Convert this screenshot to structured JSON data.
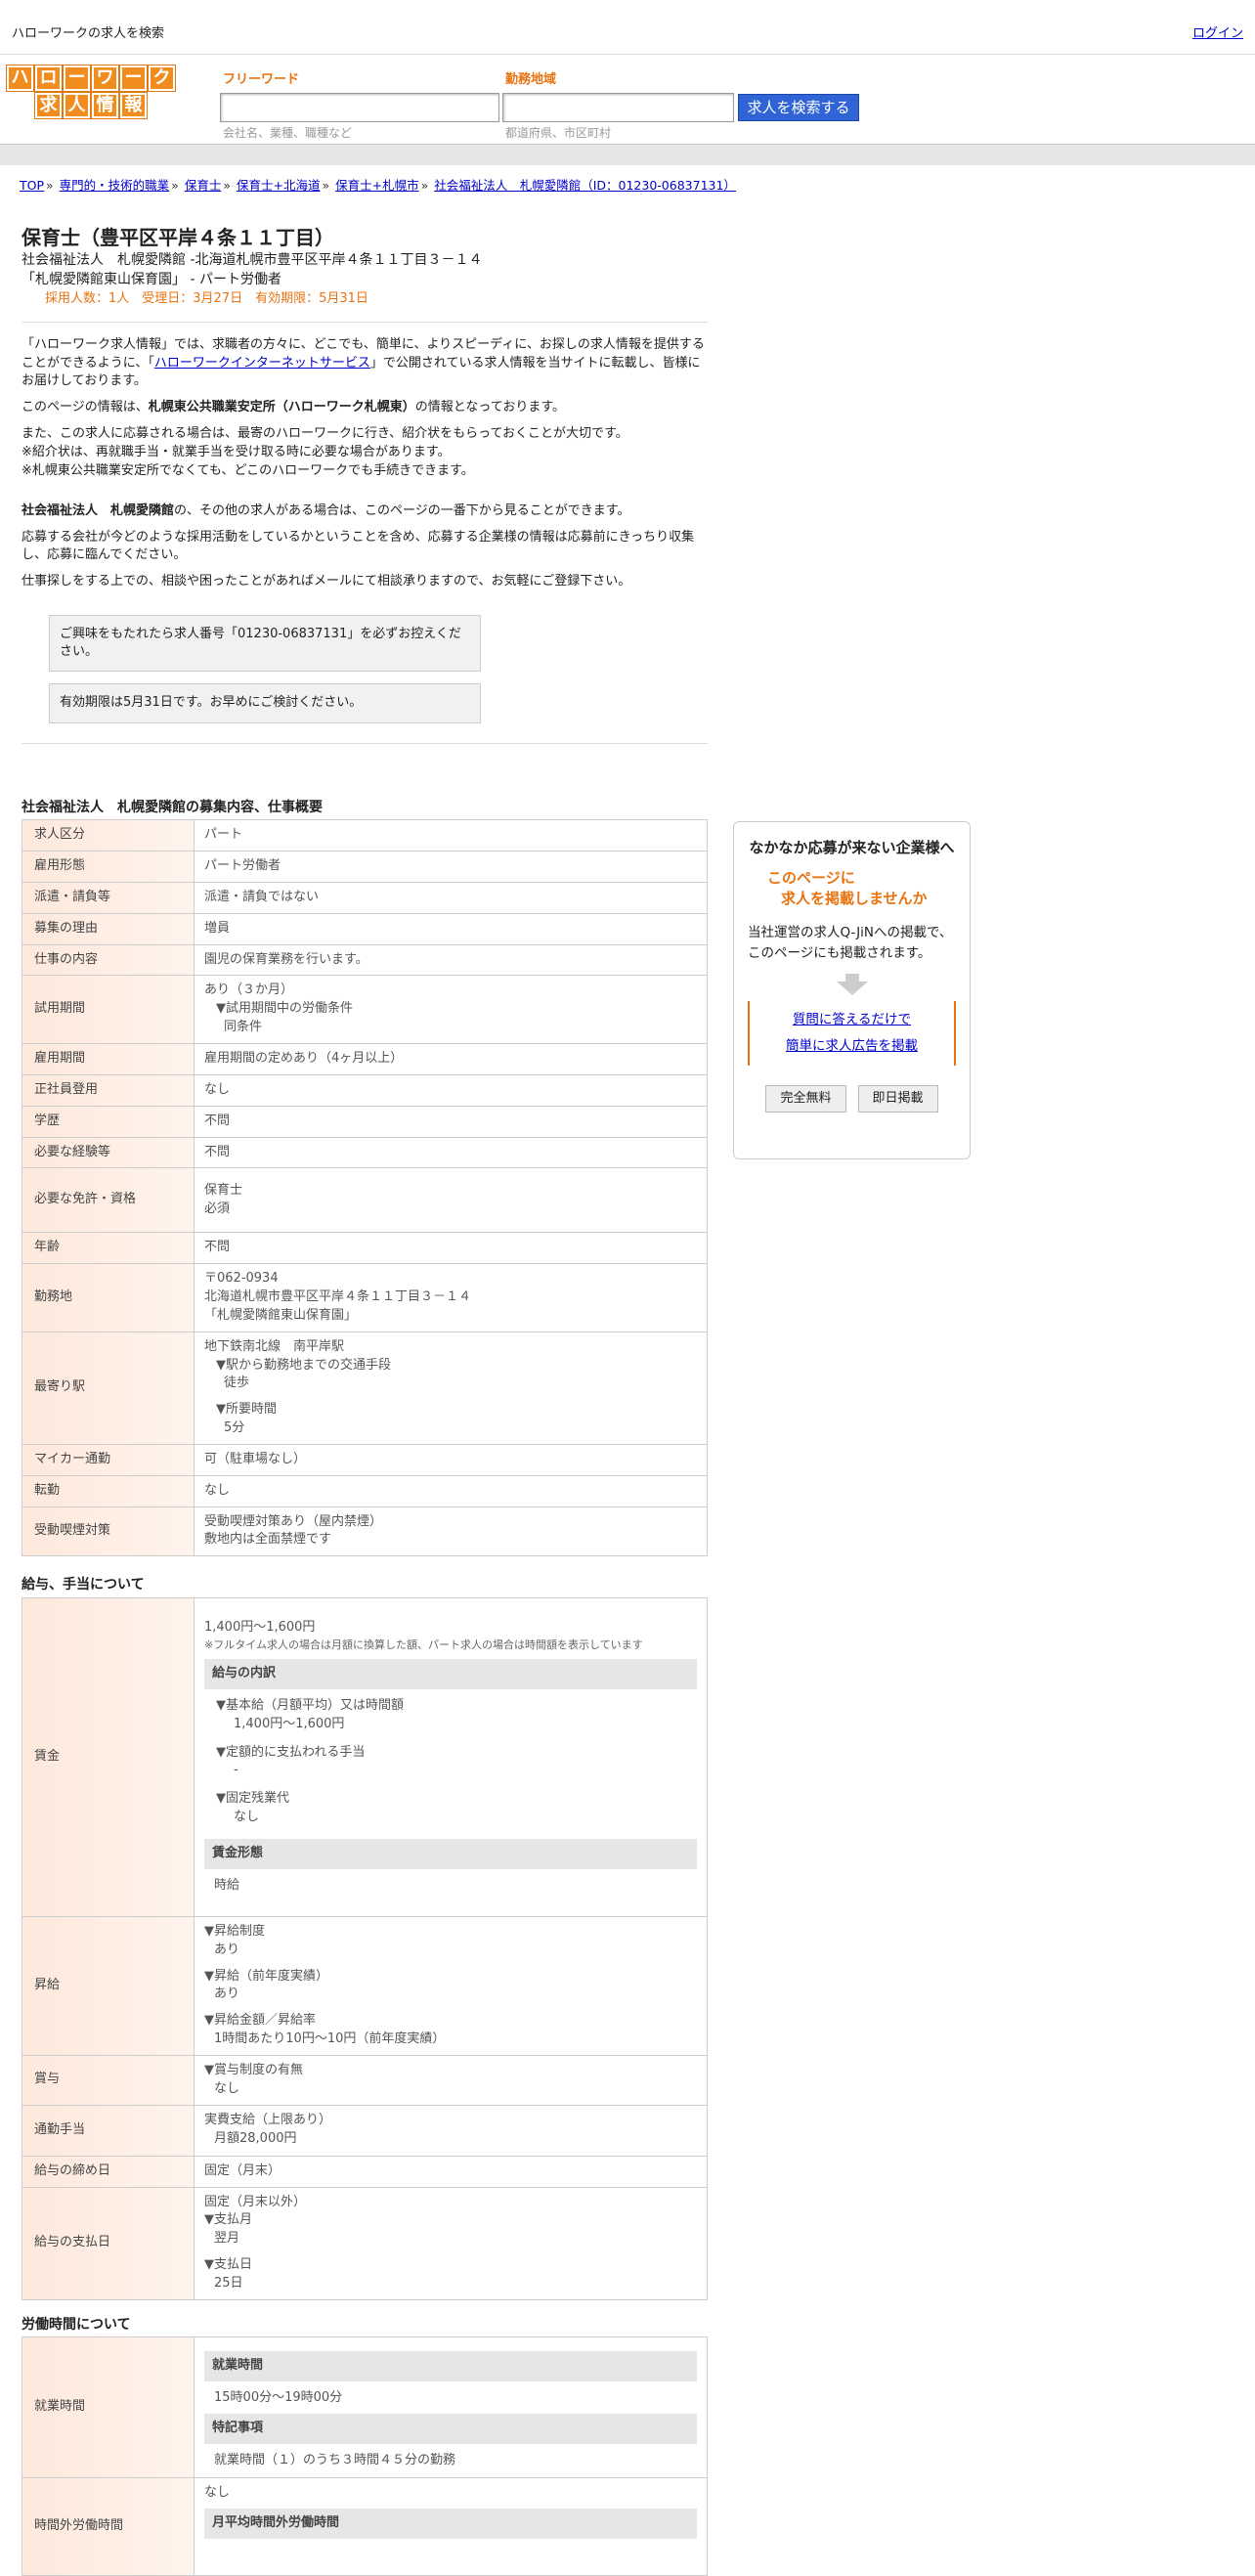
{
  "topbar": {
    "title": "ハローワークの求人を検索",
    "login": "ログイン"
  },
  "logo": {
    "row1": [
      "ハ",
      "ロ",
      "ー",
      "ワ",
      "ー",
      "ク"
    ],
    "row2": [
      "求",
      "人",
      "情",
      "報"
    ]
  },
  "search": {
    "keyword_label": "フリーワード",
    "keyword_hint": "会社名、業種、職種など",
    "area_label": "勤務地域",
    "area_hint": "都道府県、市区町村",
    "button": "求人を検索する"
  },
  "breadcrumb": [
    "TOP",
    "専門的・技術的職業",
    "保育士",
    "保育士+北海道",
    "保育士+札幌市",
    "社会福祉法人　札幌愛隣館（ID：01230-06837131）"
  ],
  "job": {
    "title": "保育士（豊平区平岸４条１１丁目）",
    "company_line": "社会福祉法人　札幌愛隣館 -北海道札幌市豊平区平岸４条１１丁目３－１４",
    "workplace_line": "「札幌愛隣館東山保育園」 - パート労働者",
    "meta": "採用人数：1人　受理日：3月27日　有効期限：5月31日"
  },
  "intro": {
    "p1a": "「ハローワーク求人情報」では、求職者の方々に、どこでも、簡単に、よりスピーディに、お探しの求人情報を提供することができるように、「",
    "p1link": "ハローワークインターネットサービス",
    "p1b": "」で公開されている求人情報を当サイトに転載し、皆様にお届けしております。",
    "p2a": "このページの情報は、",
    "p2b": "札幌東公共職業安定所（ハローワーク札幌東）",
    "p2c": "の情報となっております。",
    "p3": [
      "また、この求人に応募される場合は、最寄のハローワークに行き、紹介状をもらっておくことが大切です。",
      "※紹介状は、再就職手当・就業手当を受け取る時に必要な場合があります。",
      "※札幌東公共職業安定所でなくても、どこのハローワークでも手続きできます。"
    ],
    "p4a": "社会福祉法人　札幌愛隣館",
    "p4b": "の、その他の求人がある場合は、このページの一番下から見ることができます。",
    "p5": "応募する会社が今どのような採用活動をしているかということを含め、応募する企業様の情報は応募前にきっちり収集し、応募に臨んでください。",
    "p6": "仕事探しをする上での、相談や困ったことがあればメールにて相談承りますので、お気軽にご登録下さい。",
    "box1": "ご興味をもたれたら求人番号「01230-06837131」を必ずお控えください。",
    "box2": "有効期限は5月31日です。お早めにご検討ください。"
  },
  "overview": {
    "heading": "社会福祉法人　札幌愛隣館の募集内容、仕事概要",
    "rows": [
      {
        "h": "求人区分",
        "v": "パート"
      },
      {
        "h": "雇用形態",
        "v": "パート労働者"
      },
      {
        "h": "派遣・請負等",
        "v": "派遣・請負ではない"
      },
      {
        "h": "募集の理由",
        "v": "増員"
      },
      {
        "h": "仕事の内容",
        "v": "園児の保育業務を行います。"
      },
      {
        "h": "試用期間",
        "v1": "あり（３か月）",
        "v2": "▼試用期間中の労働条件",
        "v3": "同条件"
      },
      {
        "h": "雇用期間",
        "v": "雇用期間の定めあり（4ヶ月以上）"
      },
      {
        "h": "正社員登用",
        "v": "なし"
      },
      {
        "h": "学歴",
        "v": "不問"
      },
      {
        "h": "必要な経験等",
        "v": "不問"
      },
      {
        "h": "必要な免許・資格",
        "v1": "保育士",
        "v2": "必須"
      },
      {
        "h": "年齢",
        "v": "不問"
      },
      {
        "h": "勤務地",
        "v1": "〒062-0934",
        "v2": "北海道札幌市豊平区平岸４条１１丁目３－１４",
        "v3": "「札幌愛隣館東山保育園」"
      },
      {
        "h": "最寄り駅",
        "v1": "地下鉄南北線　南平岸駅",
        "v2": "▼駅から勤務地までの交通手段",
        "v3": "徒歩",
        "v4": "▼所要時間",
        "v5": "5分"
      },
      {
        "h": "マイカー通勤",
        "v": "可（駐車場なし）"
      },
      {
        "h": "転勤",
        "v": "なし"
      },
      {
        "h": "受動喫煙対策",
        "v1": "受動喫煙対策あり（屋内禁煙）",
        "v2": "敷地内は全面禁煙です"
      }
    ]
  },
  "salary": {
    "heading": "給与、手当について",
    "wage_h": "賃金",
    "wage_range": "1,400円〜1,600円",
    "wage_note": "※フルタイム求人の場合は月額に換算した額、パート求人の場合は時間額を表示しています",
    "breakdown_h": "給与の内訳",
    "base_label": "▼基本給（月額平均）又は時間額",
    "base_val": "1,400円〜1,600円",
    "fixed_label": "▼定額的に支払われる手当",
    "fixed_val": "-",
    "ot_label": "▼固定残業代",
    "ot_val": "なし",
    "form_h": "賃金形態",
    "form_val": "時給",
    "raise_h": "昇給",
    "raise1": "▼昇給制度",
    "raise1v": "あり",
    "raise2": "▼昇給（前年度実績）",
    "raise2v": "あり",
    "raise3": "▼昇給金額／昇給率",
    "raise3v": "1時間あたり10円〜10円（前年度実績）",
    "bonus_h": "賞与",
    "bonus1": "▼賞与制度の有無",
    "bonus1v": "なし",
    "commute_h": "通勤手当",
    "commute1": "実費支給（上限あり）",
    "commute2": "月額28,000円",
    "close_h": "給与の締め日",
    "close_v": "固定（月末）",
    "pay_h": "給与の支払日",
    "pay1": "固定（月末以外）",
    "pay2": "▼支払月",
    "pay2v": "翌月",
    "pay3": "▼支払日",
    "pay3v": "25日"
  },
  "hours": {
    "heading": "労働時間について",
    "work_h": "就業時間",
    "work_sub": "就業時間",
    "work_val": "15時00分〜19時00分",
    "note_sub": "特記事項",
    "note_val": "就業時間（１）のうち３時間４５分の勤務",
    "ot_h": "時間外労働時間",
    "ot_val": "なし",
    "ot_sub": "月平均時間外労働時間"
  },
  "aside": {
    "title": "なかなか応募が来ない企業様へ",
    "line1": "このページに",
    "line2": "求人を掲載しませんか",
    "desc1": "当社運営の求人Q-JiNへの掲載で、",
    "desc2": "このページにも掲載されます。",
    "link1": "質問に答えるだけで",
    "link2": "簡単に求人広告を掲載",
    "btn1": "完全無料",
    "btn2": "即日掲載"
  }
}
